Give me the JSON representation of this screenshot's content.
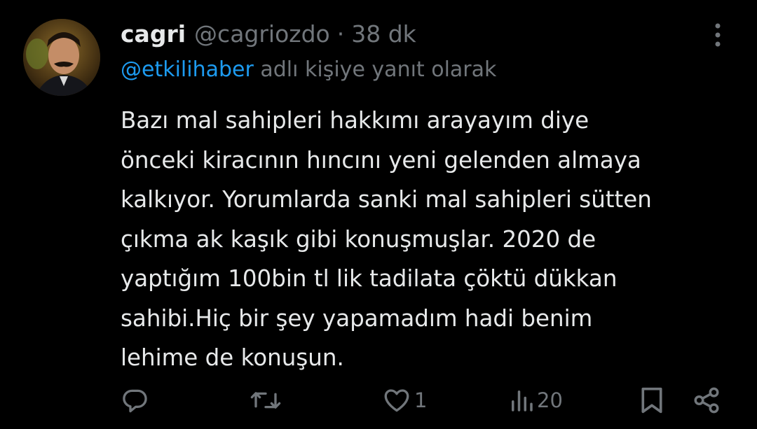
{
  "tweet": {
    "display_name": "cagri",
    "handle": "@cagriozdo",
    "separator": "·",
    "time": "38 dk",
    "reply_to": {
      "mention": "@etkilihaber",
      "suffix": " adlı kişiye yanıt olarak"
    },
    "text": "Bazı mal sahipleri hakkımı arayayım diye\nönceki kiracının hıncını yeni gelenden almaya\nkalkıyor. Yorumlarda sanki mal sahipleri sütten\nçıkma ak kaşık gibi konuşmuşlar. 2020 de\nyaptığım 100bin tl lik tadilata çöktü dükkan\nsahibi.Hiç bir şey yapamadım hadi benim\nlehime de konuşun."
  },
  "actions": {
    "reply": {
      "icon": "reply-icon"
    },
    "retweet": {
      "icon": "retweet-icon"
    },
    "like": {
      "icon": "heart-icon",
      "count": "1"
    },
    "views": {
      "icon": "views-icon",
      "count": "20"
    },
    "bookmark": {
      "icon": "bookmark-icon"
    },
    "share": {
      "icon": "share-icon"
    }
  },
  "colors": {
    "background": "#000000",
    "text": "#e7e9ea",
    "secondary": "#71767b",
    "accent": "#1d9bf0"
  }
}
